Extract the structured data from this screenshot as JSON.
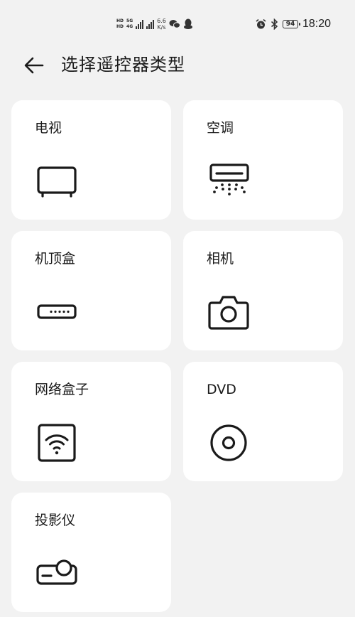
{
  "status_bar": {
    "sim1": "HD",
    "sim1_net": "5G",
    "sim2": "HD",
    "sim2_net": "4G",
    "speed_value": "6.6",
    "speed_unit": "K/s",
    "battery": "94",
    "time": "18:20"
  },
  "header": {
    "title": "选择遥控器类型"
  },
  "devices": [
    {
      "label": "电视",
      "icon": "tv-icon"
    },
    {
      "label": "空调",
      "icon": "air-conditioner-icon"
    },
    {
      "label": "机顶盒",
      "icon": "set-top-box-icon"
    },
    {
      "label": "相机",
      "icon": "camera-icon"
    },
    {
      "label": "网络盒子",
      "icon": "network-box-icon"
    },
    {
      "label": "DVD",
      "icon": "dvd-icon"
    },
    {
      "label": "投影仪",
      "icon": "projector-icon"
    }
  ]
}
